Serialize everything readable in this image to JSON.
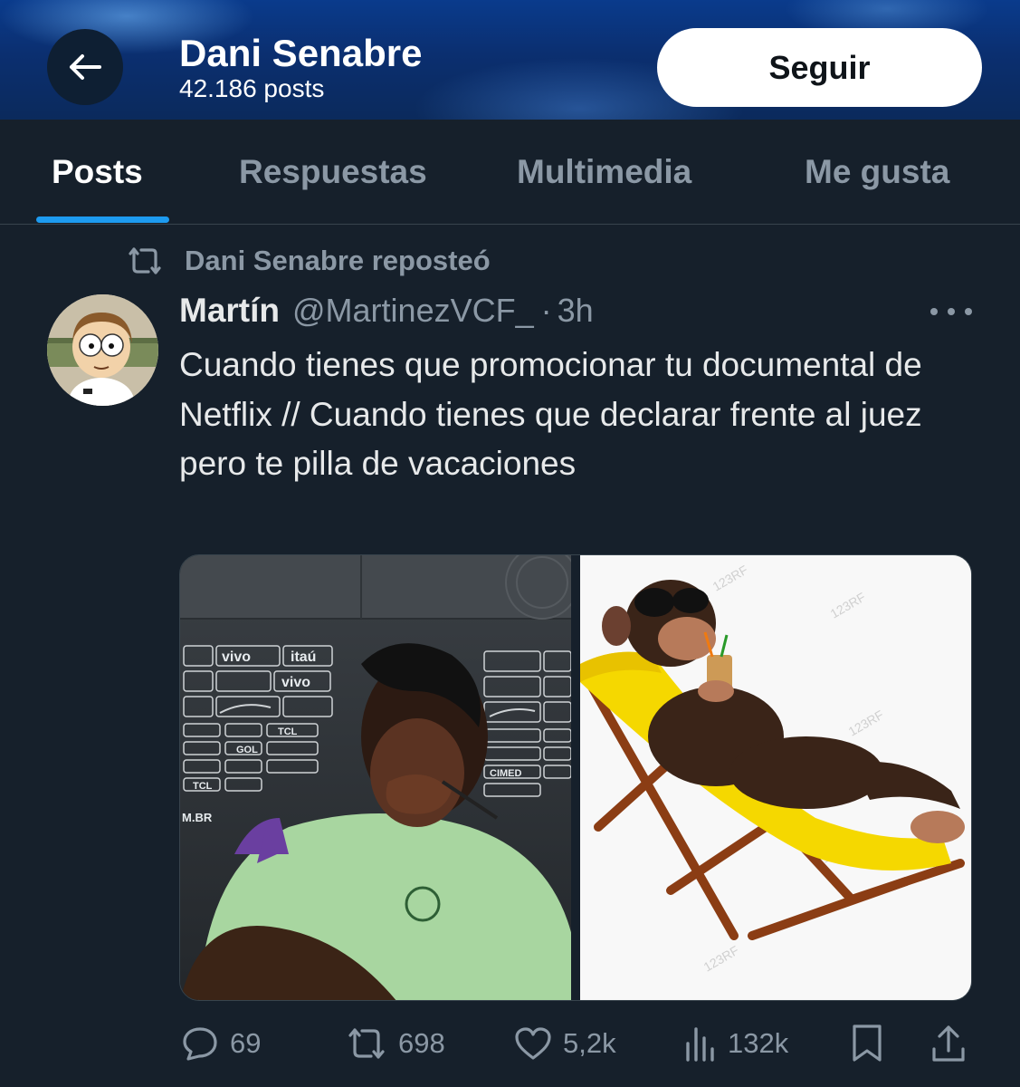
{
  "header": {
    "name": "Dani Senabre",
    "post_count": "42.186 posts",
    "follow_label": "Seguir"
  },
  "tabs": [
    {
      "label": "Posts",
      "active": true
    },
    {
      "label": "Respuestas",
      "active": false
    },
    {
      "label": "Multimedia",
      "active": false
    },
    {
      "label": "Me gusta",
      "active": false
    }
  ],
  "repost": {
    "text": "Dani Senabre reposteó"
  },
  "tweet": {
    "author_name": "Martín",
    "author_handle": "@MartinezVCF_",
    "separator": "·",
    "time": "3h",
    "text": "Cuando tienes que promocionar tu documental de Netflix // Cuando tienes que declarar frente al juez pero te pilla de vacaciones",
    "media": {
      "left_sponsor_words": [
        "vivo",
        "itaú",
        "vivo",
        "TCL",
        "GOL",
        "TCL",
        "CIMED",
        "M.BR"
      ],
      "right_watermark": "123RF"
    },
    "stats": {
      "replies": "69",
      "reposts": "698",
      "likes": "5,2k",
      "views": "132k"
    }
  },
  "colors": {
    "background": "#16202b",
    "accent": "#1d9bf0",
    "muted": "#8b98a5",
    "header_blue": "#0b2f70"
  },
  "icons": [
    "back-arrow-icon",
    "repost-icon",
    "more-icon",
    "reply-icon",
    "like-icon",
    "views-icon",
    "bookmark-icon",
    "share-icon"
  ]
}
